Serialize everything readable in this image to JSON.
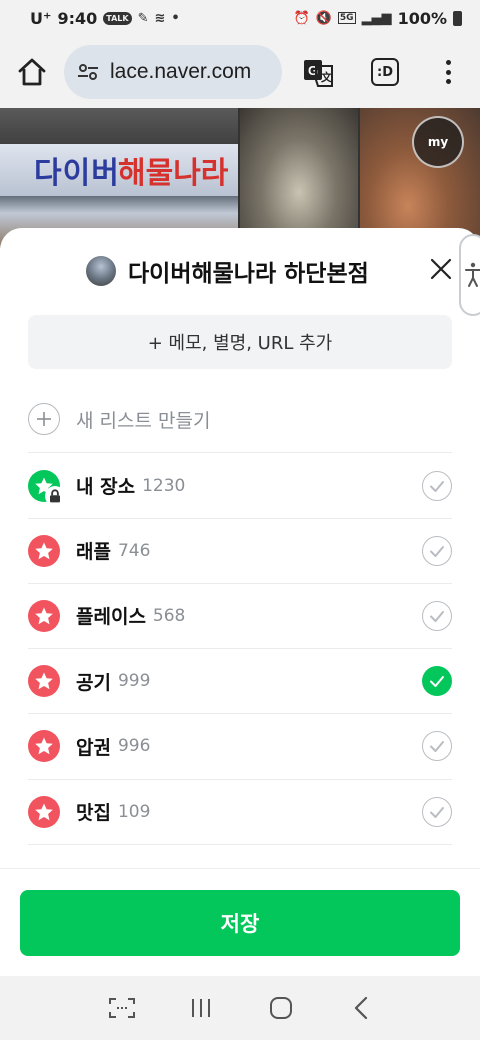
{
  "status_bar": {
    "carrier": "U⁺",
    "time": "9:40",
    "talk_badge": "TALK",
    "signal_badge": "5G",
    "battery": "100%"
  },
  "browser": {
    "url": "lace.naver.com",
    "tabs_label": ":D"
  },
  "background": {
    "sign_text_blue": "다이버",
    "sign_text_red": "해물나라",
    "badge_label": "my"
  },
  "sheet": {
    "title": "다이버해물나라 하단본점",
    "memo_button": "+ 메모, 별명, URL 추가",
    "new_list_label": "새 리스트 만들기",
    "lists": [
      {
        "name": "내 장소",
        "count": "1230",
        "checked": false,
        "icon_color": "#03c75a",
        "locked": true
      },
      {
        "name": "래플",
        "count": "746",
        "checked": false,
        "icon_color": "#f2545f",
        "locked": false
      },
      {
        "name": "플레이스",
        "count": "568",
        "checked": false,
        "icon_color": "#f2545f",
        "locked": false
      },
      {
        "name": "공기",
        "count": "999",
        "checked": true,
        "icon_color": "#f2545f",
        "locked": false
      },
      {
        "name": "압권",
        "count": "996",
        "checked": false,
        "icon_color": "#f2545f",
        "locked": false
      },
      {
        "name": "맛집",
        "count": "109",
        "checked": false,
        "icon_color": "#f2545f",
        "locked": false
      }
    ],
    "save_button": "저장"
  },
  "colors": {
    "accent_green": "#03c75a",
    "star_red": "#f2545f"
  },
  "icons": [
    "home-icon",
    "tune-icon",
    "translate-icon",
    "tabs-icon",
    "more-vert-icon",
    "close-icon",
    "accessibility-icon",
    "plus-circle-icon",
    "star-icon",
    "lock-icon",
    "check-icon",
    "recents-icon",
    "home-nav-icon",
    "back-icon",
    "screenshot-icon"
  ]
}
